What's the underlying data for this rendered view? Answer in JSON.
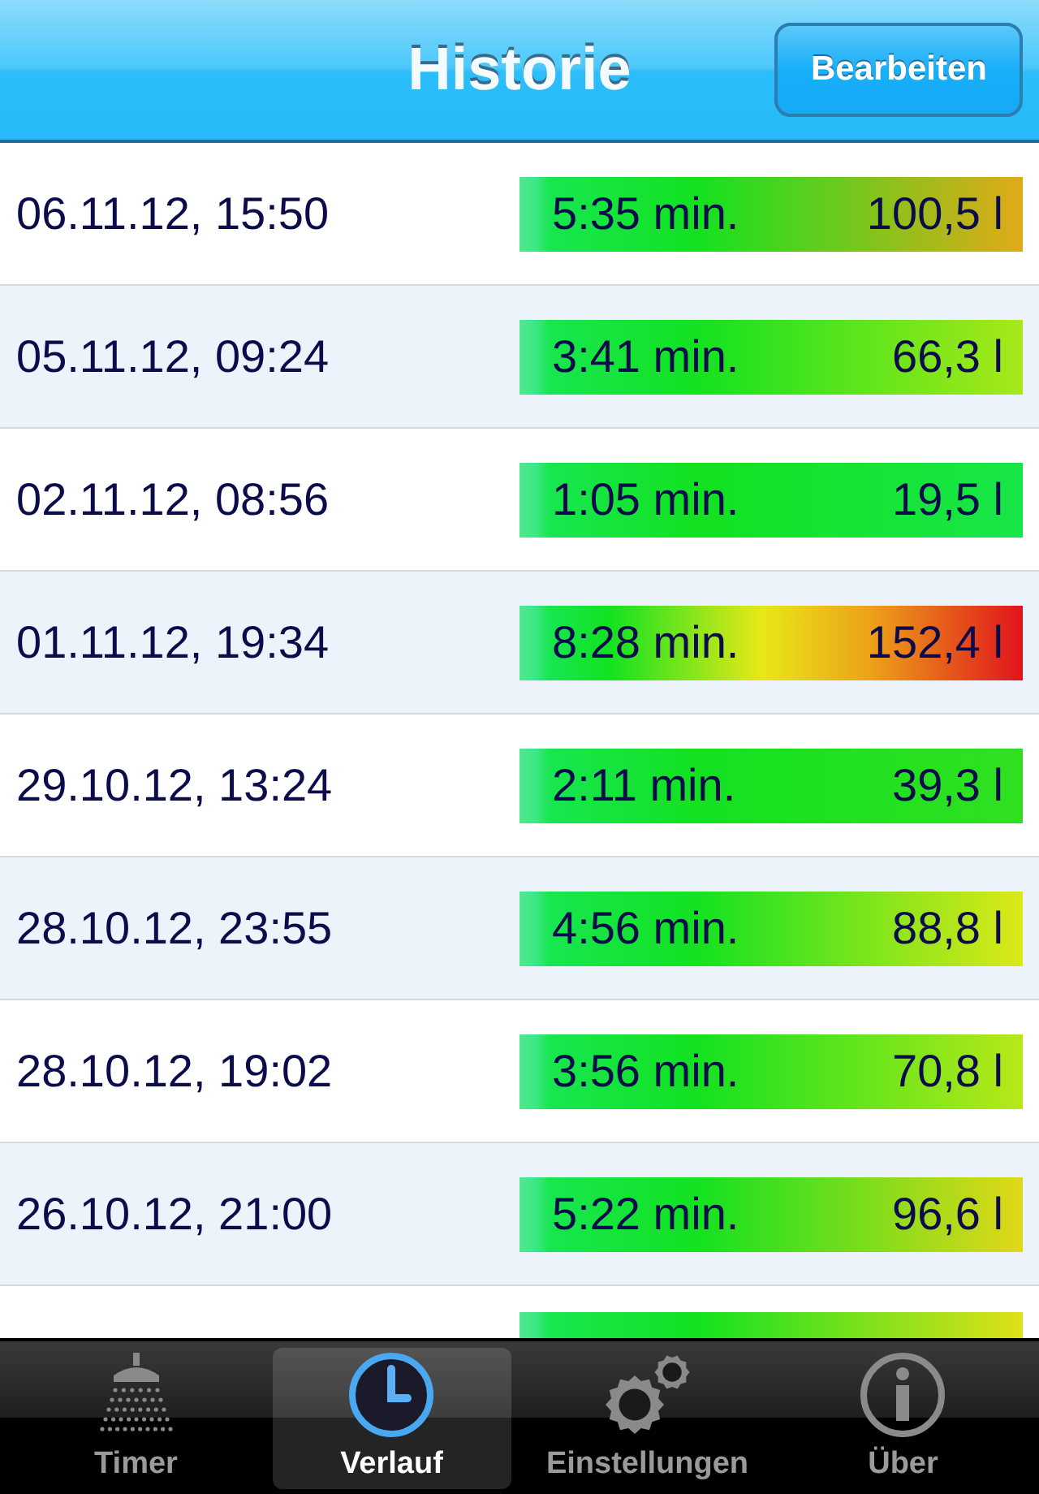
{
  "nav_bar": {
    "title": "Historie",
    "edit_button": "Bearbeiten"
  },
  "rows": [
    {
      "date": "06.11.12, 15:50",
      "duration": "5:35 min.",
      "volume": "100,5 l",
      "color": "#e0aa18"
    },
    {
      "date": "05.11.12, 09:24",
      "duration": "3:41 min.",
      "volume": "66,3 l",
      "color": "#a8e818"
    },
    {
      "date": "02.11.12, 08:56",
      "duration": "1:05 min.",
      "volume": "19,5 l",
      "color": "#18e648"
    },
    {
      "date": "01.11.12, 19:34",
      "duration": "8:28 min.",
      "volume": "152,4 l",
      "color": "#e0141c"
    },
    {
      "date": "29.10.12, 13:24",
      "duration": "2:11 min.",
      "volume": "39,3 l",
      "color": "#30e020"
    },
    {
      "date": "28.10.12, 23:55",
      "duration": "4:56 min.",
      "volume": "88,8 l",
      "color": "#dce818"
    },
    {
      "date": "28.10.12, 19:02",
      "duration": "3:56 min.",
      "volume": "70,8 l",
      "color": "#b8e818"
    },
    {
      "date": "26.10.12, 21:00",
      "duration": "5:22 min.",
      "volume": "96,6 l",
      "color": "#e0d818"
    },
    {
      "color": "#e0e018"
    }
  ],
  "tab_bar": [
    {
      "kind": "shower",
      "label": "Timer",
      "selected": false
    },
    {
      "kind": "clock",
      "label": "Verlauf",
      "selected": true
    },
    {
      "kind": "gears",
      "label": "Einstellungen",
      "selected": false
    },
    {
      "kind": "info",
      "label": "Über",
      "selected": false
    }
  ]
}
